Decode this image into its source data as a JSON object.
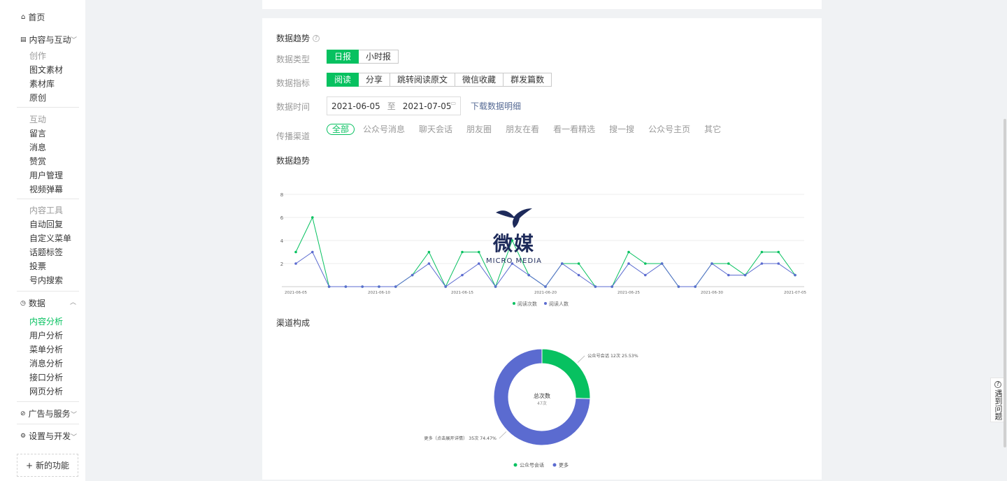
{
  "sidebar": {
    "home": "首页",
    "content_group": {
      "label": "内容与互动",
      "creation_title": "创作",
      "creation_items": [
        "图文素材",
        "素材库",
        "原创"
      ],
      "interaction_title": "互动",
      "interaction_items": [
        "留言",
        "消息",
        "赞赏",
        "用户管理",
        "视频弹幕"
      ],
      "tools_title": "内容工具",
      "tools_items": [
        "自动回复",
        "自定义菜单",
        "话题标签",
        "投票",
        "号内搜索"
      ]
    },
    "data_group": {
      "label": "数据",
      "items": [
        "内容分析",
        "用户分析",
        "菜单分析",
        "消息分析",
        "接口分析",
        "网页分析"
      ],
      "active_index": 0
    },
    "ads_group": {
      "label": "广告与服务"
    },
    "settings_group": {
      "label": "设置与开发"
    },
    "new_feature": "新的功能"
  },
  "main": {
    "trend_title": "数据趋势",
    "data_type": {
      "label": "数据类型",
      "options": [
        "日报",
        "小时报"
      ],
      "selected": 0
    },
    "metric": {
      "label": "数据指标",
      "options": [
        "阅读",
        "分享",
        "跳转阅读原文",
        "微信收藏",
        "群发篇数"
      ],
      "selected": 0
    },
    "time": {
      "label": "数据时间",
      "start": "2021-06-05",
      "sep": "至",
      "end": "2021-07-05",
      "download": "下载数据明细"
    },
    "channel": {
      "label": "传播渠道",
      "options": [
        "全部",
        "公众号消息",
        "聊天会话",
        "朋友圈",
        "朋友在看",
        "看一看精选",
        "搜一搜",
        "公众号主页",
        "其它"
      ],
      "selected": 0
    },
    "chart_title": "数据趋势",
    "pie_title": "渠道构成"
  },
  "watermark": {
    "text": "MICRO MEDIA",
    "glyphs": "微媒"
  },
  "feedback": "遇到问题",
  "colors": {
    "accent": "#07c160",
    "series_green": "#07c160",
    "series_blue": "#5b6bd0",
    "link": "#576b95"
  },
  "chart_data": [
    {
      "type": "line",
      "x": [
        "2021-06-05",
        "2021-06-06",
        "2021-06-07",
        "2021-06-08",
        "2021-06-09",
        "2021-06-10",
        "2021-06-11",
        "2021-06-12",
        "2021-06-13",
        "2021-06-14",
        "2021-06-15",
        "2021-06-16",
        "2021-06-17",
        "2021-06-18",
        "2021-06-19",
        "2021-06-20",
        "2021-06-21",
        "2021-06-22",
        "2021-06-23",
        "2021-06-24",
        "2021-06-25",
        "2021-06-26",
        "2021-06-27",
        "2021-06-28",
        "2021-06-29",
        "2021-06-30",
        "2021-07-01",
        "2021-07-02",
        "2021-07-03",
        "2021-07-04",
        "2021-07-05"
      ],
      "x_tick_labels": [
        "2021-06-05",
        "2021-06-10",
        "2021-06-15",
        "2021-06-20",
        "2021-06-25",
        "2021-06-30",
        "2021-07-05"
      ],
      "series": [
        {
          "name": "阅读次数",
          "values": [
            3,
            6,
            0,
            0,
            0,
            0,
            0,
            1,
            3,
            0,
            3,
            3,
            0,
            4,
            1,
            0,
            2,
            2,
            0,
            0,
            3,
            2,
            2,
            0,
            0,
            2,
            2,
            1,
            3,
            3,
            1
          ]
        },
        {
          "name": "阅读人数",
          "values": [
            2,
            3,
            0,
            0,
            0,
            0,
            0,
            1,
            2,
            0,
            1,
            2,
            0,
            2,
            1,
            0,
            2,
            1,
            0,
            0,
            2,
            1,
            2,
            0,
            0,
            2,
            1,
            1,
            2,
            2,
            1
          ]
        }
      ],
      "y_ticks": [
        2,
        4,
        6,
        8
      ],
      "ylim": [
        0,
        8
      ],
      "grid": true,
      "legend": "bottom"
    },
    {
      "type": "pie",
      "center_title": "总次数",
      "center_value": "47次",
      "slices": [
        {
          "name": "公众号会话",
          "value": 12,
          "percent": "25.53%",
          "label": "公众号会话 12次 25.53%"
        },
        {
          "name": "更多",
          "value": 35,
          "percent": "74.47%",
          "label": "更多（点击展开详情） 35次 74.47%"
        }
      ],
      "legend": "bottom"
    }
  ]
}
